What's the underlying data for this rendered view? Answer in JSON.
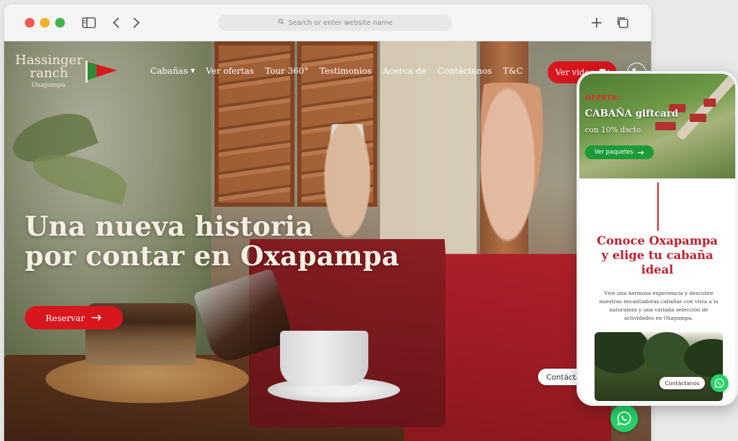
{
  "browser": {
    "address_placeholder": "Search or enter website name"
  },
  "site": {
    "logo_line1": "Hassinger",
    "logo_line2": "ranch",
    "logo_sub": "Oxapampa",
    "nav": [
      {
        "label": "Cabañas",
        "dropdown": true
      },
      {
        "label": "Ver ofertas"
      },
      {
        "label": "Tour 360°"
      },
      {
        "label": "Testimonios"
      },
      {
        "label": "Acerca de"
      },
      {
        "label": "Contáctanos"
      },
      {
        "label": "T&C"
      }
    ],
    "video_button": "Ver video",
    "hero_title_line1": "Una nueva historia",
    "hero_title_line2": "por contar en Oxapampa",
    "reserve_button": "Reservar",
    "contact_pill": "Contáctanos"
  },
  "mobile": {
    "offer_label": "OFERTA:",
    "offer_title": "CABAÑA giftcard",
    "offer_sub": "con 10% dscto.",
    "offer_button": "Ver paquetes",
    "heading_line1": "Conoce Oxapampa",
    "heading_line2": "y elige tu cabaña",
    "heading_line3": "ideal",
    "body": "Vive una hermosa experiencia y descubre nuestras encantadoras cabañas con vista a la naturaleza y una variada selección de actividades en Oxapampa.",
    "contact_pill": "Contáctanos"
  },
  "colors": {
    "brand_red": "#d7161e",
    "whatsapp_green": "#25d366",
    "flag_green": "#2f8a3a"
  },
  "icons": [
    "sidebar-icon",
    "back-icon",
    "forward-icon",
    "search-icon",
    "new-tab-icon",
    "tabs-overview-icon",
    "flag-icon",
    "chevron-down-icon",
    "video-icon",
    "phone-icon",
    "arrow-right-icon",
    "whatsapp-icon"
  ]
}
